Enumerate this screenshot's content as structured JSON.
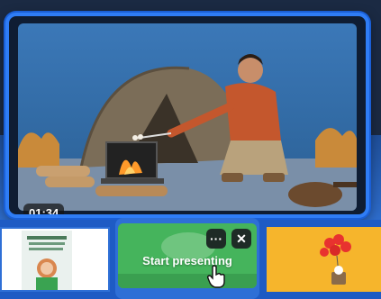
{
  "video": {
    "duration": "01:34"
  },
  "slides": {
    "active": {
      "action_label": "Start presenting",
      "more_icon": "more-horizontal-icon",
      "close_icon": "close-icon"
    }
  },
  "colors": {
    "accent": "#2f7df6",
    "active_slide": "#35a34f",
    "slide_three": "#f6b52c"
  }
}
